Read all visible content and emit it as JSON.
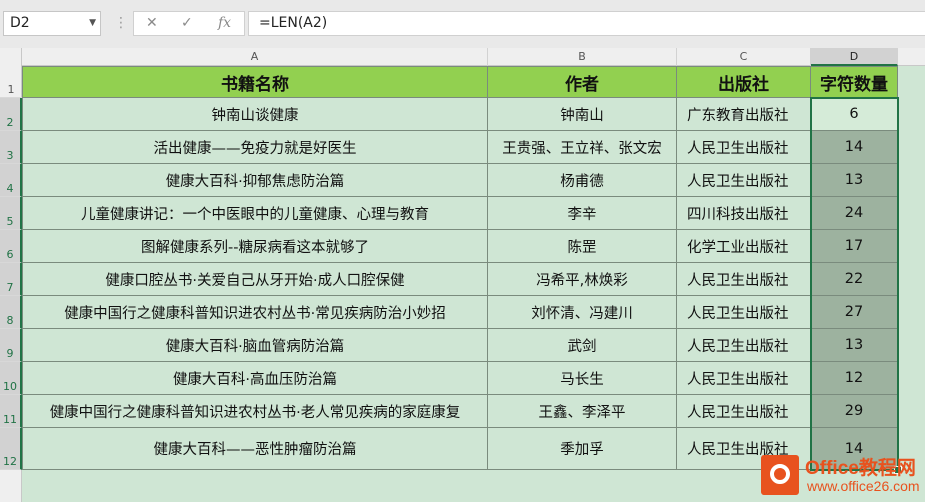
{
  "formula_bar": {
    "name_box": "D2",
    "cancel_icon": "✕",
    "enter_icon": "✓",
    "function_icon": "fx",
    "formula": "=LEN(A2)"
  },
  "columns": [
    "A",
    "B",
    "C",
    "D"
  ],
  "rows": [
    "1",
    "2",
    "3",
    "4",
    "5",
    "6",
    "7",
    "8",
    "9",
    "10",
    "11",
    "12"
  ],
  "table": {
    "headers": [
      "书籍名称",
      "作者",
      "出版社",
      "字符数量"
    ],
    "data": [
      {
        "title": "钟南山谈健康",
        "author": "钟南山",
        "publisher": "广东教育出版社",
        "count": "6"
      },
      {
        "title": "活出健康——免疫力就是好医生",
        "author": "王贵强、王立祥、张文宏",
        "publisher": "人民卫生出版社",
        "count": "14"
      },
      {
        "title": "健康大百科·抑郁焦虑防治篇",
        "author": "杨甫德",
        "publisher": "人民卫生出版社",
        "count": "13"
      },
      {
        "title": "儿童健康讲记：一个中医眼中的儿童健康、心理与教育",
        "author": "李辛",
        "publisher": "四川科技出版社",
        "count": "24"
      },
      {
        "title": "图解健康系列--糖尿病看这本就够了",
        "author": "陈罡",
        "publisher": "化学工业出版社",
        "count": "17"
      },
      {
        "title": "健康口腔丛书·关爱自己从牙开始·成人口腔保健",
        "author": "冯希平,林焕彩",
        "publisher": "人民卫生出版社",
        "count": "22"
      },
      {
        "title": "健康中国行之健康科普知识进农村丛书·常见疾病防治小妙招",
        "author": "刘怀清、冯建川",
        "publisher": "人民卫生出版社",
        "count": "27"
      },
      {
        "title": "健康大百科·脑血管病防治篇",
        "author": "武剑",
        "publisher": "人民卫生出版社",
        "count": "13"
      },
      {
        "title": "健康大百科·高血压防治篇",
        "author": "马长生",
        "publisher": "人民卫生出版社",
        "count": "12"
      },
      {
        "title": "健康中国行之健康科普知识进农村丛书·老人常见疾病的家庭康复",
        "author": "王鑫、李泽平",
        "publisher": "人民卫生出版社",
        "count": "29"
      },
      {
        "title": "健康大百科——恶性肿瘤防治篇",
        "author": "季加孚",
        "publisher": "人民卫生出版社",
        "count": "14"
      }
    ]
  },
  "watermark": {
    "line1": "Office教程网",
    "line2": "www.office26.com"
  },
  "colors": {
    "header_fill": "#92d050",
    "body_fill": "#cfe6d4",
    "selected_fill": "#9db29f",
    "selection_border": "#217346",
    "logo": "#e8521e"
  }
}
